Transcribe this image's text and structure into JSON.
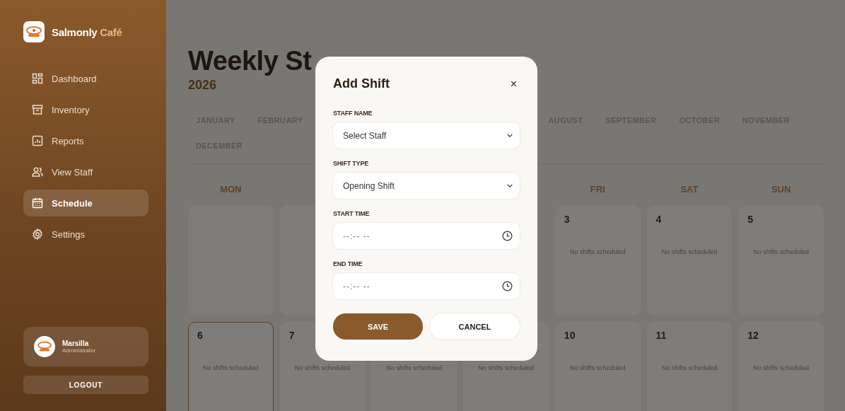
{
  "brand": {
    "name": "Salmonly",
    "accent": "Café"
  },
  "sidebar": {
    "items": [
      {
        "label": "Dashboard",
        "kind": "dashboard",
        "selected": false
      },
      {
        "label": "Inventory",
        "kind": "inventory",
        "selected": false
      },
      {
        "label": "Reports",
        "kind": "reports",
        "selected": false
      },
      {
        "label": "View Staff",
        "kind": "staff",
        "selected": false
      },
      {
        "label": "Schedule",
        "kind": "schedule",
        "selected": true
      },
      {
        "label": "Settings",
        "kind": "settings",
        "selected": false
      }
    ],
    "user": {
      "name": "Marsilla",
      "role": "Administrator"
    },
    "logout": "LOGOUT"
  },
  "page": {
    "title": "Weekly St",
    "year": "2026"
  },
  "month_tabs": [
    "JANUARY",
    "FEBRUARY",
    "AUGUST",
    "SEPTEMBER",
    "OCTOBER",
    "NOVEMBER",
    "DECEMBER"
  ],
  "day_headers": [
    "MON",
    "FRI",
    "SAT",
    "SUN"
  ],
  "weeks": [
    {
      "days": [
        {
          "today": false
        },
        {
          "today": false
        },
        {
          "day": "3",
          "note": "No shifts scheduled",
          "today": false
        },
        {
          "day": "4",
          "note": "No shifts scheduled",
          "today": false
        },
        {
          "day": "5",
          "note": "No shifts scheduled",
          "today": false
        }
      ]
    },
    {
      "days": [
        {
          "day": "6",
          "note": "No shifts scheduled",
          "today": true
        },
        {
          "day": "7",
          "note": "No shifts scheduled",
          "today": false
        },
        {
          "note": "No shifts scheduled",
          "today": false
        },
        {
          "note": "No shifts scheduled",
          "today": false
        },
        {
          "day": "10",
          "note": "No shifts scheduled",
          "today": false
        },
        {
          "day": "11",
          "note": "No shifts scheduled",
          "today": false
        },
        {
          "day": "12",
          "note": "No shifts scheduled",
          "today": false
        }
      ]
    }
  ],
  "modal": {
    "title": "Add Shift",
    "close": "×",
    "fields": [
      {
        "label": "STAFF NAME",
        "kind": "select",
        "value": "Select Staff"
      },
      {
        "label": "SHIFT TYPE",
        "kind": "select",
        "value": "Opening Shift"
      },
      {
        "label": "START TIME",
        "kind": "time",
        "placeholder": "--:-- --"
      },
      {
        "label": "END TIME",
        "kind": "time",
        "placeholder": "--:-- --"
      }
    ],
    "buttons": [
      {
        "label": "SAVE",
        "kind": "primary"
      },
      {
        "label": "CANCEL",
        "kind": "secondary"
      }
    ]
  }
}
